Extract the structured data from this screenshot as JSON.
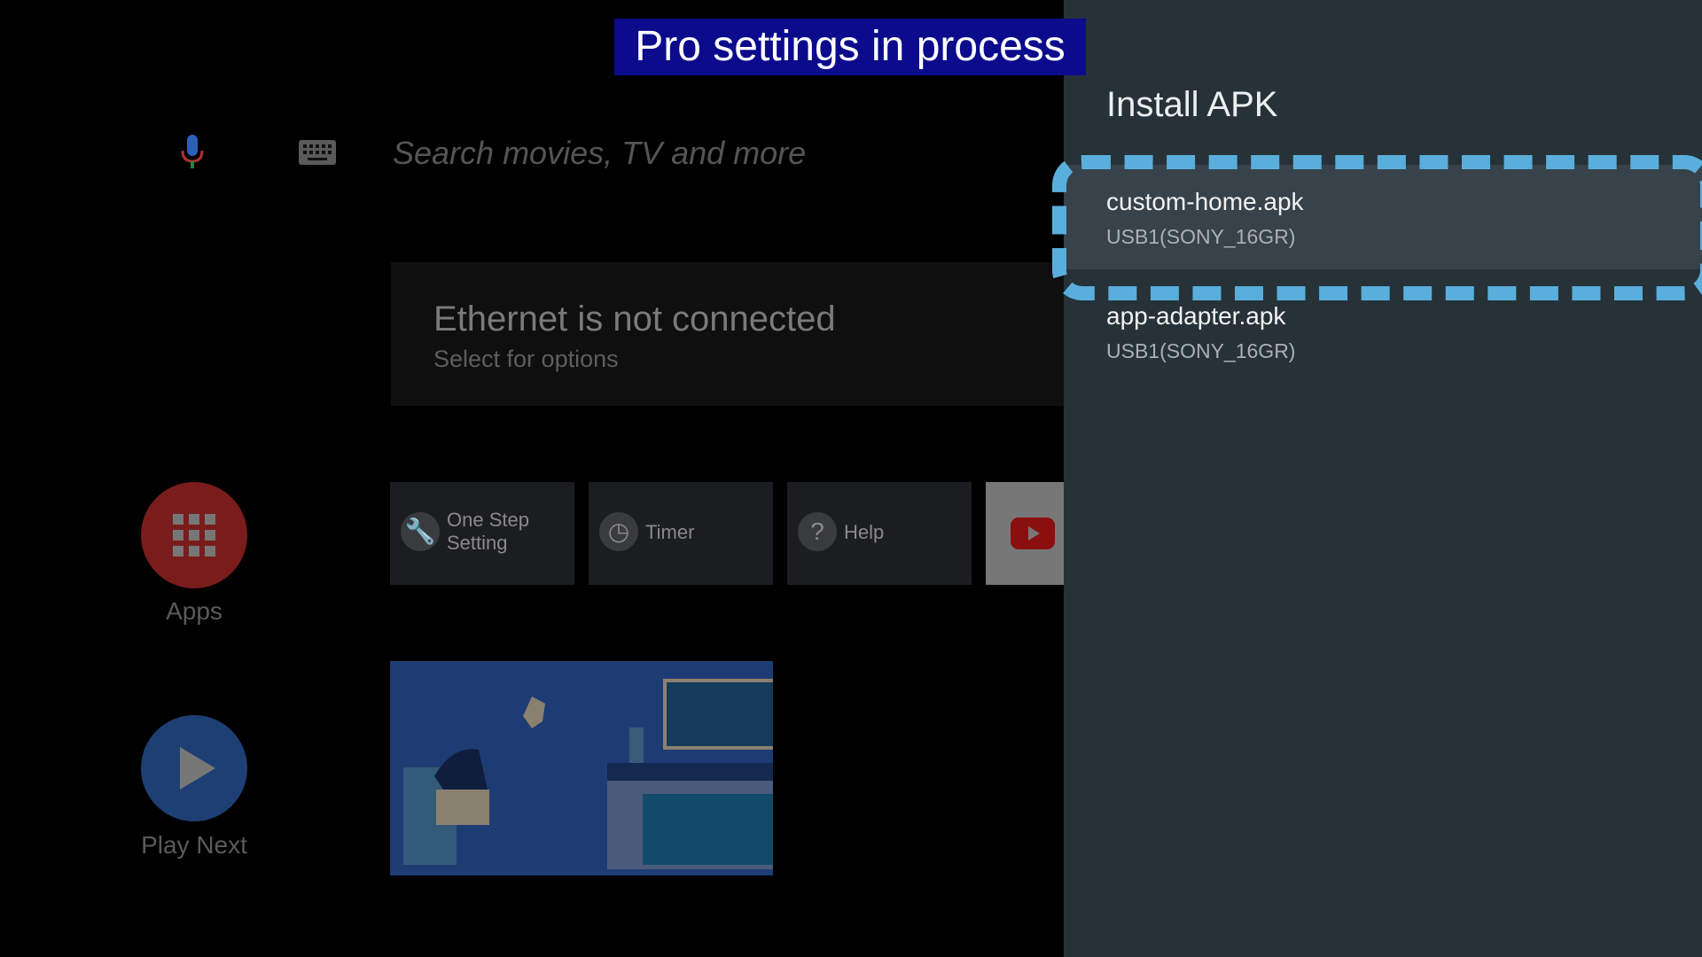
{
  "banner": {
    "text": "Pro settings in process"
  },
  "search": {
    "placeholder": "Search movies, TV and more",
    "mic_icon": "mic-icon",
    "keyboard_icon": "keyboard-icon"
  },
  "network": {
    "title": "Ethernet is not connected",
    "subtitle": "Select for options"
  },
  "nav": [
    {
      "label": "Apps",
      "icon": "apps-grid-icon",
      "color": "#7a1c1c"
    },
    {
      "label": "Play Next",
      "icon": "play-icon",
      "color": "#1e3f73"
    }
  ],
  "tiles": [
    {
      "label": "One Step Setting",
      "icon": "wrench-icon"
    },
    {
      "label": "Timer",
      "icon": "timer-icon"
    },
    {
      "label": "Help",
      "icon": "help-icon"
    },
    {
      "label": "",
      "icon": "youtube-icon"
    }
  ],
  "panel": {
    "title": "Install APK",
    "items": [
      {
        "name": "custom-home.apk",
        "source": "USB1(SONY_16GR)",
        "selected": true
      },
      {
        "name": "app-adapter.apk",
        "source": "USB1(SONY_16GR)",
        "selected": false
      }
    ]
  },
  "colors": {
    "panel_bg": "#263238",
    "focus_outline": "#5aaedc",
    "banner_bg": "#0b0b8c"
  }
}
